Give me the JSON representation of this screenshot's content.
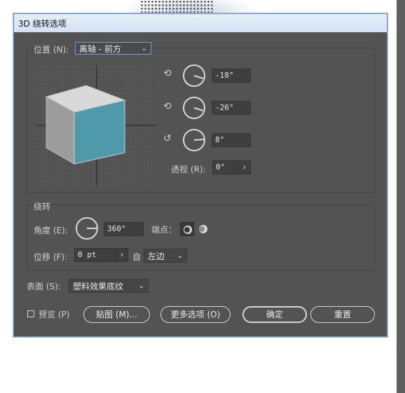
{
  "dialog": {
    "title": "3D 绕转选项"
  },
  "position": {
    "group_label": "位置 (N):",
    "preset_value": "离轴 - 前方",
    "rot_x_value": "-18°",
    "rot_y_value": "-26°",
    "rot_z_value": "8°",
    "perspective_label": "透视 (R):",
    "perspective_value": "0°",
    "perspective_arrow": "›"
  },
  "revolve": {
    "group_label": "绕转",
    "angle_label": "角度 (E):",
    "angle_value": "360°",
    "cap_label": "端点：",
    "offset_label": "位移 (F):",
    "offset_value": "0 pt",
    "offset_arrow": "›",
    "from_label": "自",
    "from_value": "左边"
  },
  "surface": {
    "label": "表面 (S):",
    "value": "塑料效果底纹"
  },
  "footer": {
    "preview_label": "预览 (P)",
    "map_button": "贴图 (M)...",
    "more_options_button": "更多选项 (O)",
    "ok_button": "确定",
    "reset_button": "重置"
  },
  "colors": {
    "cube_front": "#4f9aaa",
    "cube_side": "#9c9c9c",
    "cube_top": "#d9d9d9",
    "dialog_bg": "#535353"
  },
  "icons": {
    "rot_x": "rotate-x-axis-icon",
    "rot_y": "rotate-y-axis-icon",
    "rot_z": "rotate-z-axis-icon",
    "cap_on": "cap-on-icon",
    "cap_off": "cap-off-icon",
    "chevron": "chevron-down-icon"
  }
}
